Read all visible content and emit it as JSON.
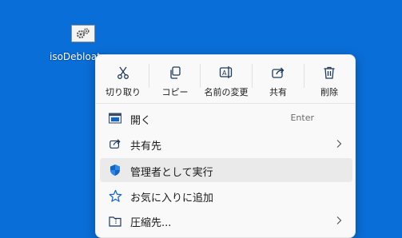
{
  "desktop": {
    "file_name": "isoDebloate...",
    "background": "#0a6ed8"
  },
  "context_menu": {
    "toolbar": [
      {
        "label": "切り取り",
        "icon": "cut-icon"
      },
      {
        "label": "コピー",
        "icon": "copy-icon"
      },
      {
        "label": "名前の変更",
        "icon": "rename-icon"
      },
      {
        "label": "共有",
        "icon": "share-icon"
      },
      {
        "label": "削除",
        "icon": "delete-icon"
      }
    ],
    "items": [
      {
        "label": "開く",
        "shortcut": "Enter",
        "icon": "app-window-icon"
      },
      {
        "label": "共有先",
        "icon": "share-icon",
        "submenu": true
      },
      {
        "label": "管理者として実行",
        "icon": "shield-icon",
        "highlighted": true
      },
      {
        "label": "お気に入りに追加",
        "icon": "star-icon"
      },
      {
        "label": "圧縮先...",
        "icon": "zip-folder-icon",
        "submenu": true
      }
    ],
    "accent": "#1565c0"
  }
}
